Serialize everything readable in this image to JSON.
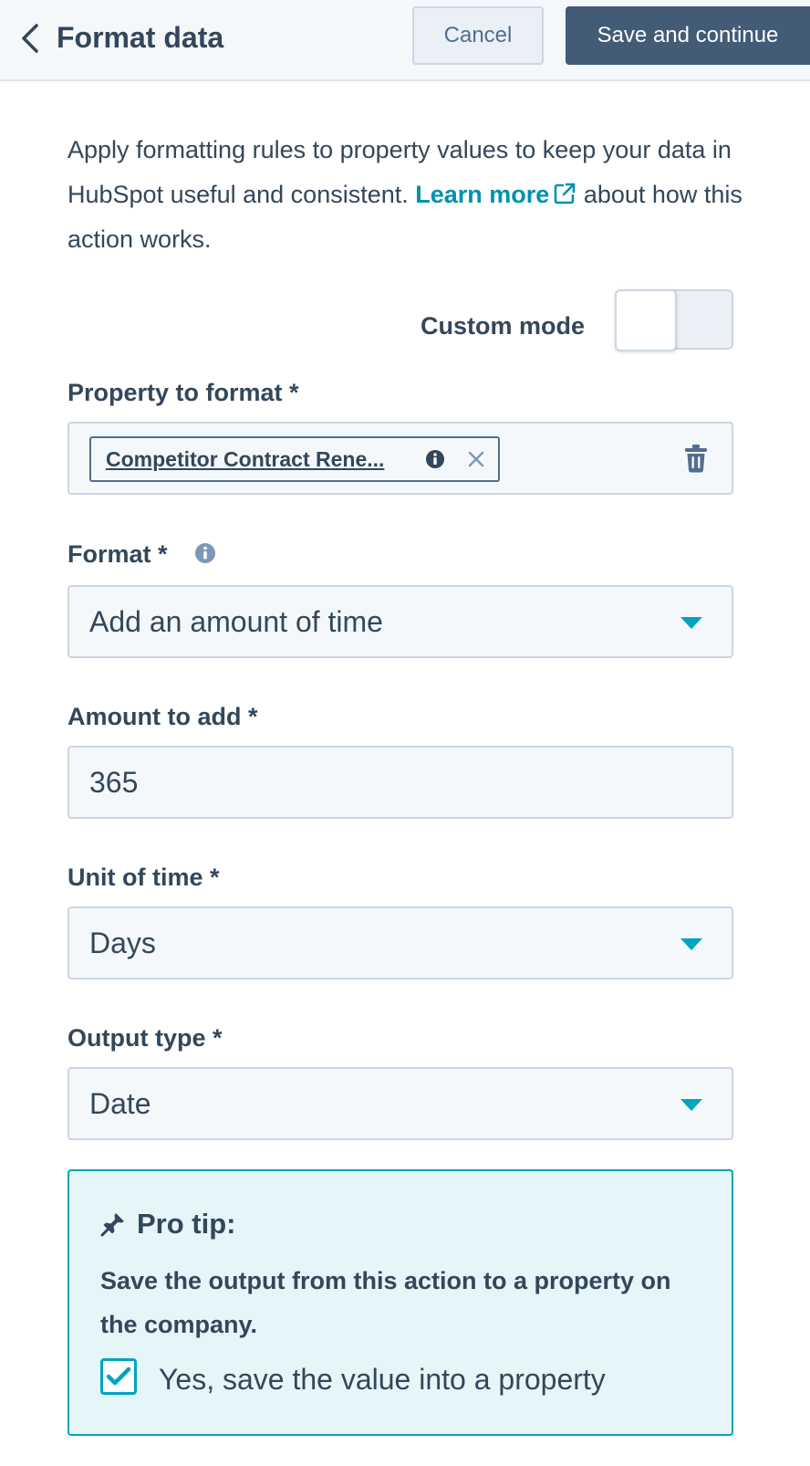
{
  "header": {
    "title": "Format data",
    "cancel_label": "Cancel",
    "save_label": "Save and continue"
  },
  "intro": {
    "text_before": "Apply formatting rules to property values to keep your data in HubSpot useful and consistent. ",
    "link_label": "Learn more",
    "text_after": " about how this action works."
  },
  "custom_mode": {
    "label": "Custom mode",
    "enabled": false
  },
  "property_field": {
    "label": "Property to format *",
    "tag_label": "Competitor Contract Rene..."
  },
  "format_field": {
    "label": "Format *",
    "value": "Add an amount of time"
  },
  "amount_field": {
    "label": "Amount to add *",
    "value": "365"
  },
  "unit_field": {
    "label": "Unit of time *",
    "value": "Days"
  },
  "output_field": {
    "label": "Output type *",
    "value": "Date"
  },
  "pro_tip": {
    "title": "Pro tip:",
    "text": "Save the output from this action to a property on the company.",
    "checkbox_label": "Yes, save the value into a property",
    "checked": true
  },
  "colors": {
    "text": "#33475b",
    "link": "#0091ae",
    "primary_button": "#425b76",
    "accent": "#00a4bd",
    "tip_background": "#e5f5f8"
  }
}
